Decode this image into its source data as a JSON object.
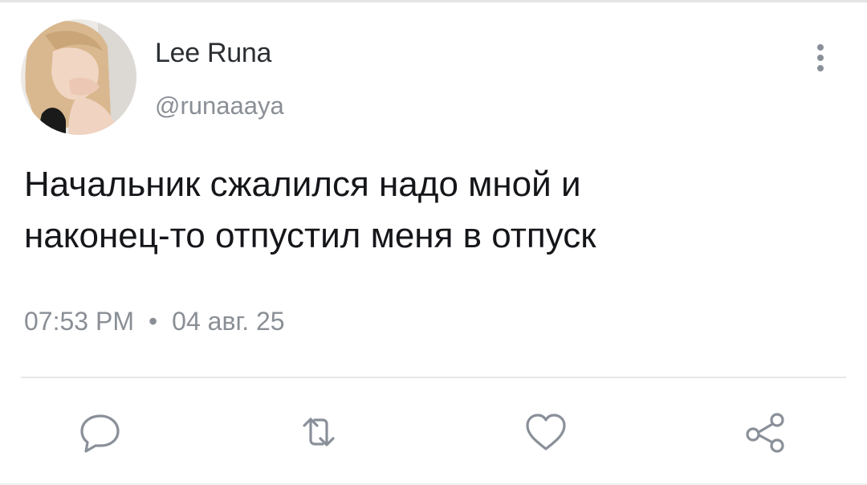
{
  "tweet": {
    "author": {
      "display_name": "Lee Runa",
      "handle": "@runaaaya"
    },
    "text_lines": [
      "Начальник сжалился надо мной и",
      "наконец-то отпустил меня в отпуск"
    ],
    "time": "07:53 PM",
    "separator": "•",
    "date": "04 авг. 25"
  },
  "actions": {
    "reply": "reply-icon",
    "retweet": "retweet-icon",
    "like": "heart-icon",
    "share": "share-icon"
  },
  "colors": {
    "name": "#2b2f33",
    "secondary_text": "#8a8f96",
    "body_text": "#141619",
    "icon": "#8a9099",
    "divider": "#e6e7e9"
  }
}
